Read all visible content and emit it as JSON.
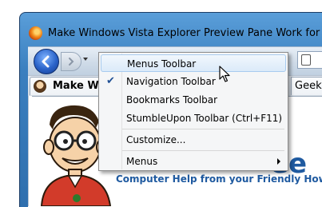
{
  "window": {
    "title": "Make Windows Vista Explorer Preview Pane Work for More File"
  },
  "navbar": {
    "back_icon": "back-arrow-icon",
    "forward_icon": "forward-arrow-icon"
  },
  "tabs": [
    {
      "label": "Make Win",
      "favicon": "howtogeek-favicon"
    },
    {
      "label": "Geek"
    }
  ],
  "content": {
    "tagline": "Computer Help from your Friendly How-To",
    "logo_fragment": "ee"
  },
  "context_menu": {
    "items": [
      {
        "label": "Menus Toolbar",
        "checked": false,
        "highlighted": true
      },
      {
        "label": "Navigation Toolbar",
        "checked": true,
        "highlighted": false
      },
      {
        "label": "Bookmarks Toolbar",
        "checked": false,
        "highlighted": false
      },
      {
        "label": "StumbleUpon Toolbar (Ctrl+F11)",
        "checked": false,
        "highlighted": false
      },
      {
        "label": "Customize...",
        "checked": false,
        "highlighted": false
      },
      {
        "label": "Menus",
        "checked": false,
        "highlighted": false,
        "has_submenu": true
      }
    ],
    "check_glyph": "✔"
  },
  "colors": {
    "frame_blue": "#3a7fbf",
    "tagline_blue": "#1f5aa0",
    "menu_highlight": "#dbeaf9"
  }
}
